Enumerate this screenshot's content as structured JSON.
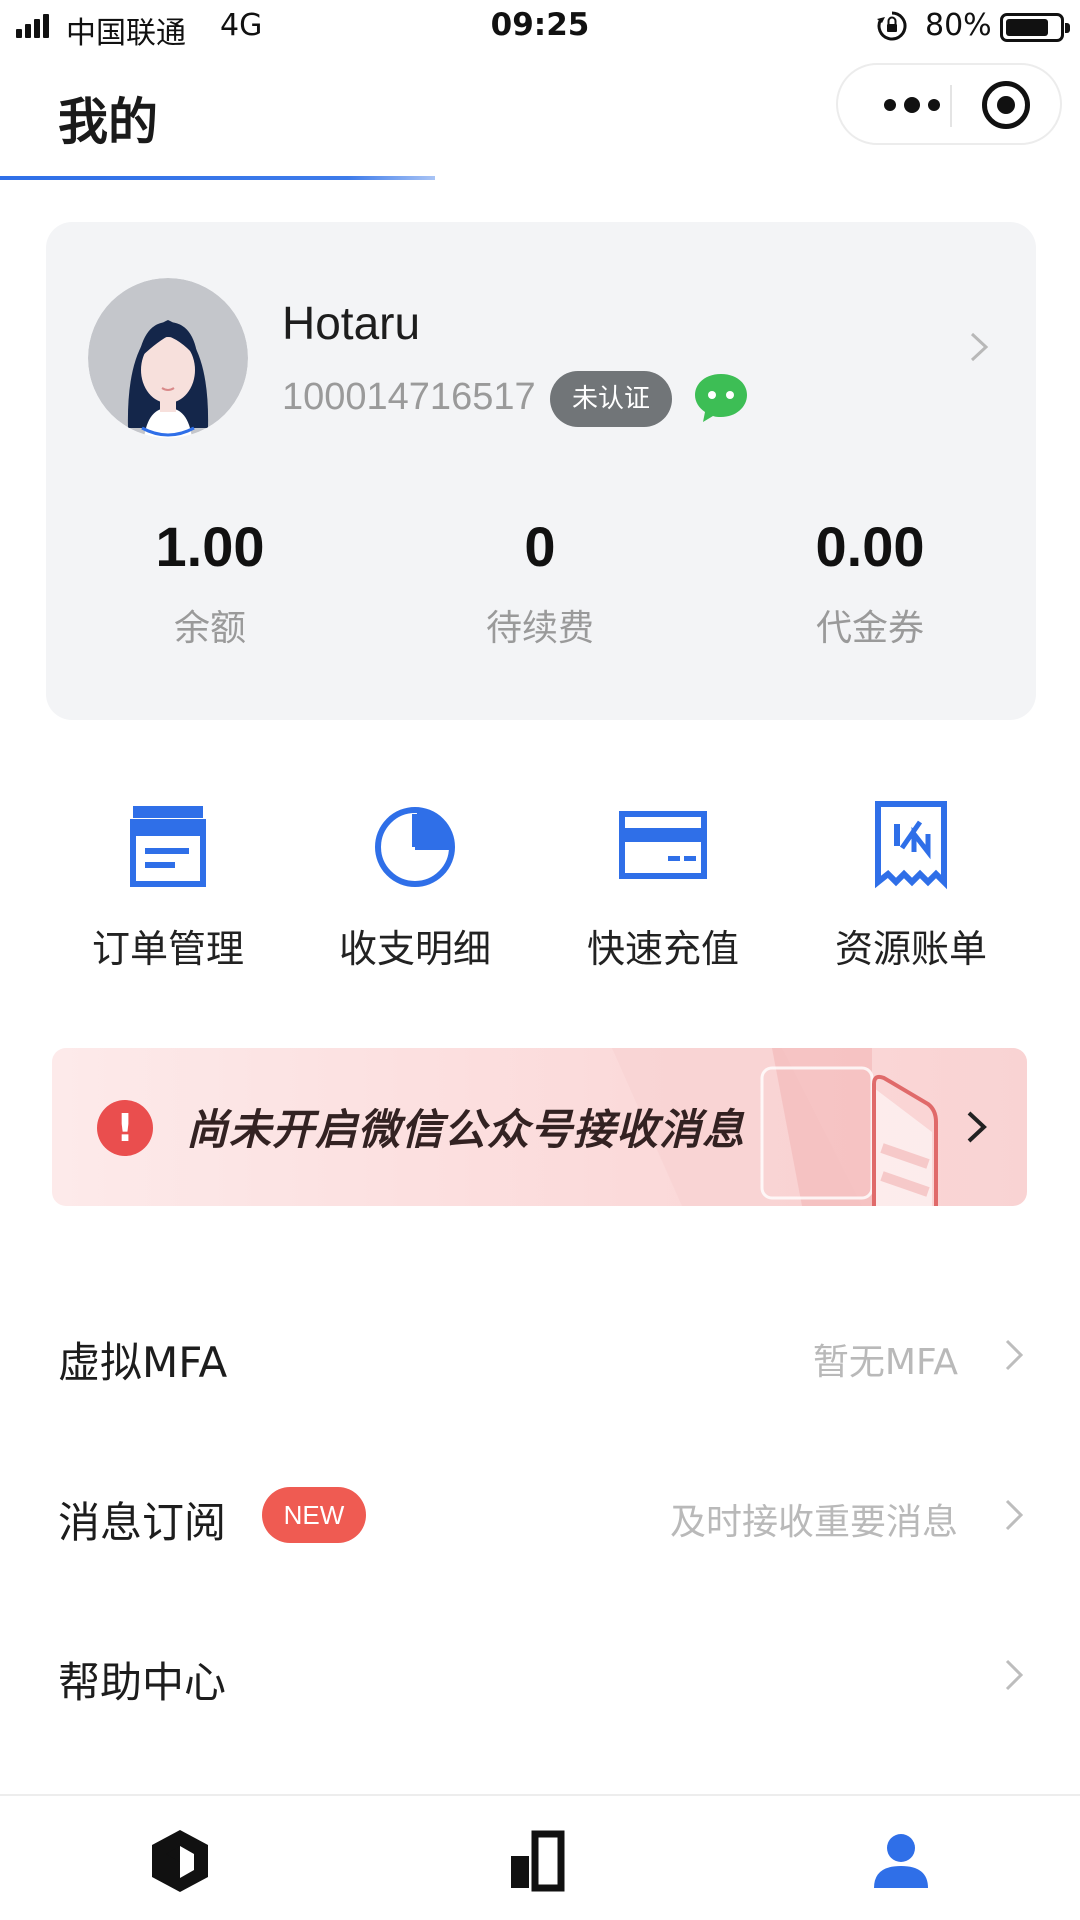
{
  "status_bar": {
    "carrier": "中国联通",
    "network": "4G",
    "time": "09:25",
    "battery": "80%",
    "battery_level": 0.8
  },
  "header": {
    "title": "我的"
  },
  "capsule": {
    "icons": [
      "more-icon",
      "target-icon"
    ]
  },
  "profile": {
    "name": "Hotaru",
    "id": "100014716517",
    "badge": "未认证"
  },
  "stats": [
    {
      "value": "1.00",
      "label": "余额"
    },
    {
      "value": "0",
      "label": "待续费"
    },
    {
      "value": "0.00",
      "label": "代金券"
    }
  ],
  "shortcuts": [
    {
      "label": "订单管理",
      "icon": "order-icon"
    },
    {
      "label": "收支明细",
      "icon": "pie-chart-icon"
    },
    {
      "label": "快速充值",
      "icon": "card-icon"
    },
    {
      "label": "资源账单",
      "icon": "bill-icon"
    }
  ],
  "banner": {
    "text": "尚未开启微信公众号接收消息"
  },
  "menu": [
    {
      "label": "虚拟MFA",
      "hint": "暂无MFA"
    },
    {
      "label": "消息订阅",
      "badge": "NEW",
      "hint": "及时接收重要消息"
    },
    {
      "label": "帮助中心"
    }
  ],
  "tabbar": {
    "icons": [
      "cube-icon",
      "chart-icon",
      "person-icon"
    ],
    "active_index": 2
  },
  "colors": {
    "accent": "#2f6fe8",
    "card_bg": "#f3f4f6",
    "badge_gray": "#717578",
    "wechat_green": "#3dbe55",
    "alert_red": "#ea4e4e",
    "new_badge": "#ef5b52"
  }
}
